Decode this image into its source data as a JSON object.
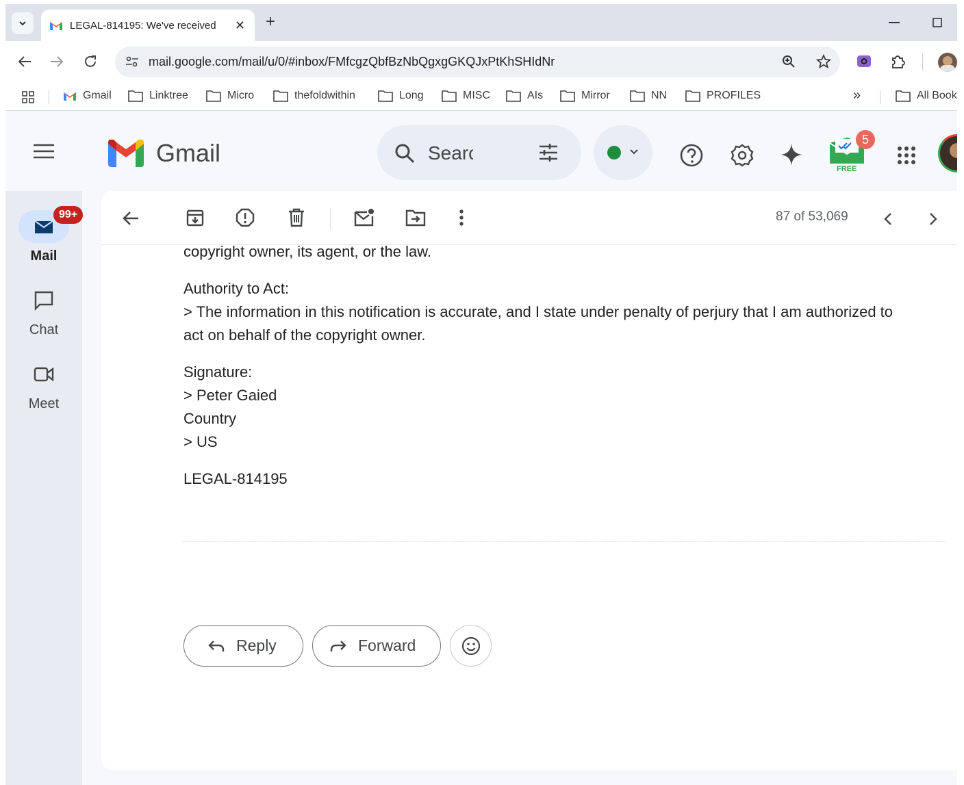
{
  "browser": {
    "tab_title": "LEGAL-814195: We've received",
    "url": "mail.google.com/mail/u/0/#inbox/FMfcgzQbfBzNbQgxgGKQJxPtKhSHIdNr",
    "bookmarks": [
      "Gmail",
      "Linktree",
      "Micro",
      "thefoldwithin",
      "Long",
      "MISC",
      "AIs",
      "Mirror",
      "NN",
      "PROFILES"
    ],
    "overflow_label": "»",
    "all_bookmarks": "All Book"
  },
  "gmail": {
    "app_name": "Gmail",
    "search_placeholder": "Search",
    "extension_badge": "5",
    "extension_label": "FREE"
  },
  "rail": {
    "mail": {
      "label": "Mail",
      "badge": "99+"
    },
    "chat": {
      "label": "Chat"
    },
    "meet": {
      "label": "Meet"
    }
  },
  "toolbar": {
    "counter": "87 of 53,069"
  },
  "message": {
    "line_top": "copyright owner, its agent, or the law.",
    "authority_heading": "Authority to Act:",
    "authority_line1": "> The information in this notification is accurate, and I state under penalty of perjury that I am authorized to",
    "authority_line2": "act on behalf of the copyright owner.",
    "signature_heading": "Signature:",
    "signature_value": "> Peter Gaied",
    "country_heading": "Country",
    "country_value": "> US",
    "reference": "LEGAL-814195"
  },
  "actions": {
    "reply": "Reply",
    "forward": "Forward"
  },
  "colors": {
    "gmail_red": "#ea4335",
    "gmail_blue": "#4285f4",
    "gmail_green": "#34a853",
    "gmail_yellow": "#fbbc04",
    "status_green": "#1e8e3e",
    "badge_red": "#c5221f"
  }
}
